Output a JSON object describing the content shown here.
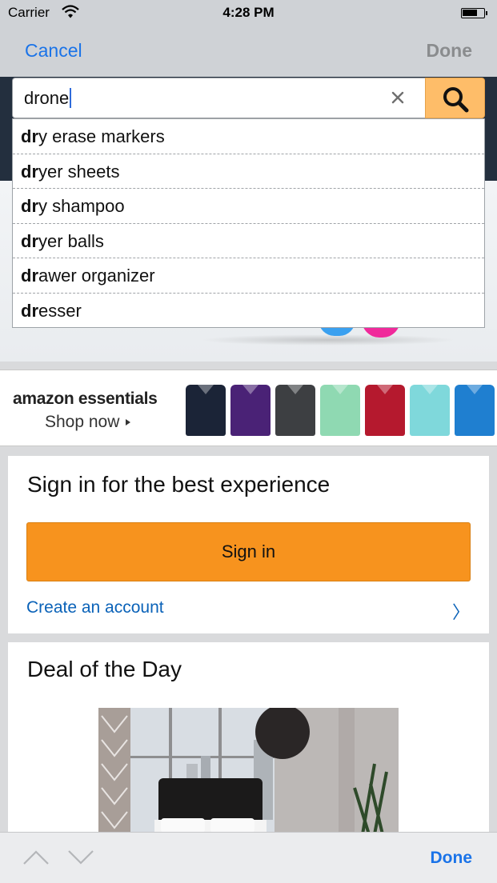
{
  "status_bar": {
    "carrier": "Carrier",
    "time": "4:28 PM"
  },
  "nav": {
    "cancel_label": "Cancel",
    "done_label": "Done"
  },
  "search": {
    "value": "drone",
    "clear_icon": "close-icon",
    "button_icon": "search-icon"
  },
  "suggestions": [
    {
      "prefix": "dr",
      "rest": "y erase markers"
    },
    {
      "prefix": "dr",
      "rest": "yer sheets"
    },
    {
      "prefix": "dr",
      "rest": "y shampoo"
    },
    {
      "prefix": "dr",
      "rest": "yer balls"
    },
    {
      "prefix": "dr",
      "rest": "awer organizer"
    },
    {
      "prefix": "dr",
      "rest": "esser"
    }
  ],
  "banner": {
    "brand": "amazon essentials",
    "cta": "Shop now",
    "shirt_colors": [
      "#1b2437",
      "#4a2276",
      "#3d3f42",
      "#8fd9b2",
      "#b5192e",
      "#7fd8db",
      "#1f7fd0"
    ]
  },
  "signin": {
    "title": "Sign in for the best experience",
    "button_label": "Sign in",
    "create_account_label": "Create an account",
    "chevron": "〉"
  },
  "deal": {
    "title": "Deal of the Day"
  },
  "toolbar": {
    "done_label": "Done"
  },
  "colors": {
    "accent_blue": "#1a73e8",
    "search_button": "#febd69",
    "signin_button": "#f7931e",
    "link_blue": "#0a62b8"
  }
}
